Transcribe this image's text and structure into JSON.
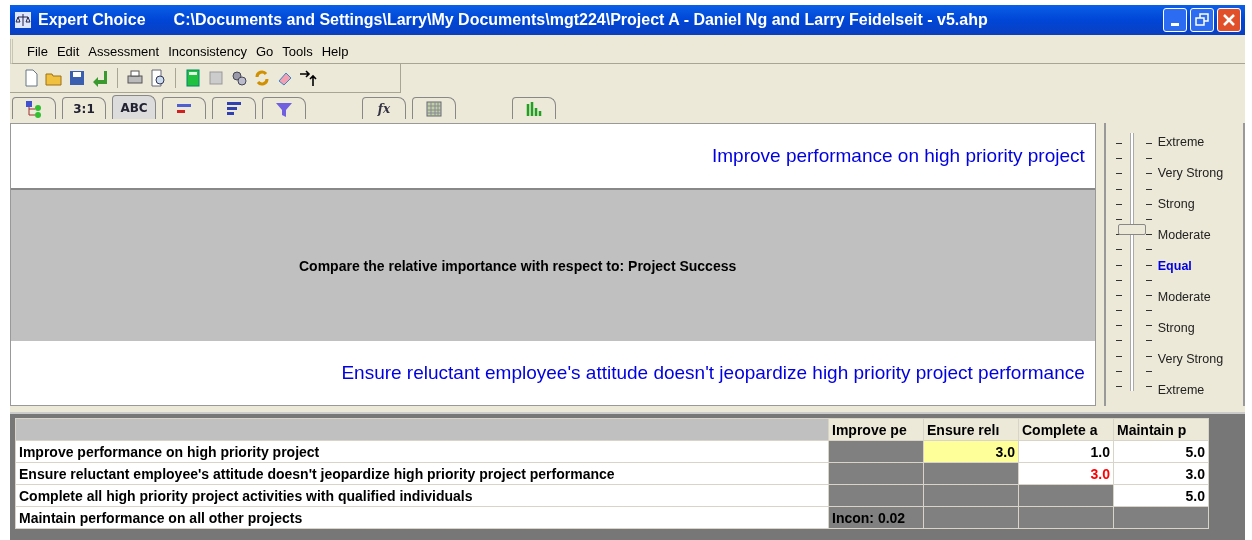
{
  "window": {
    "app_name": "Expert Choice",
    "title": "C:\\Documents and Settings\\Larry\\My Documents\\mgt224\\Project A - Daniel Ng and Larry Feidelseit - v5.ahp"
  },
  "menu": [
    "File",
    "Edit",
    "Assessment",
    "Inconsistency",
    "Go",
    "Tools",
    "Help"
  ],
  "tabs": [
    {
      "selected": false
    },
    {
      "label": "3:1",
      "selected": false
    },
    {
      "label": "ABC",
      "selected": true
    },
    {
      "selected": false
    },
    {
      "selected": false
    },
    {
      "selected": false
    },
    {
      "label": "fx",
      "selected": false
    },
    {
      "selected": false
    },
    {
      "selected": false
    }
  ],
  "comparison": {
    "top_item": "Improve performance on high priority project",
    "prompt": "Compare the relative importance with respect to: Project Success",
    "bottom_item": "Ensure reluctant employee's attitude doesn't jeopardize high priority project performance"
  },
  "scale": {
    "level": 0.625,
    "labels": [
      {
        "text": "Extreme",
        "kind": "normal"
      },
      {
        "text": "Very Strong",
        "kind": "normal"
      },
      {
        "text": "Strong",
        "kind": "normal"
      },
      {
        "text": "Moderate",
        "kind": "normal"
      },
      {
        "text": "Equal",
        "kind": "center"
      },
      {
        "text": "Moderate",
        "kind": "normal"
      },
      {
        "text": "Strong",
        "kind": "normal"
      },
      {
        "text": "Very Strong",
        "kind": "normal"
      },
      {
        "text": "Extreme",
        "kind": "normal"
      }
    ]
  },
  "matrix": {
    "columns": [
      "Improve pe",
      "Ensure relı",
      "Complete a",
      "Maintain p"
    ],
    "rows": [
      {
        "label": "Improve performance on high priority project",
        "cells": [
          {
            "kind": "empty"
          },
          {
            "kind": "value",
            "text": "3.0",
            "selected": true,
            "inverse": false
          },
          {
            "kind": "value",
            "text": "1.0",
            "selected": false,
            "inverse": false
          },
          {
            "kind": "value",
            "text": "5.0",
            "selected": false,
            "inverse": false
          }
        ]
      },
      {
        "label": "Ensure reluctant employee's attitude doesn't jeopardize high priority project performance",
        "cells": [
          {
            "kind": "empty"
          },
          {
            "kind": "empty"
          },
          {
            "kind": "value",
            "text": "3.0",
            "selected": false,
            "inverse": true
          },
          {
            "kind": "value",
            "text": "3.0",
            "selected": false,
            "inverse": false
          }
        ]
      },
      {
        "label": "Complete all high priority project activities with qualified individuals",
        "cells": [
          {
            "kind": "empty"
          },
          {
            "kind": "empty"
          },
          {
            "kind": "empty"
          },
          {
            "kind": "value",
            "text": "5.0",
            "selected": false,
            "inverse": false
          }
        ]
      },
      {
        "label": "Maintain performance on all other projects",
        "cells": [
          {
            "kind": "incon",
            "text": "Incon: 0.02"
          },
          {
            "kind": "empty"
          },
          {
            "kind": "empty"
          },
          {
            "kind": "empty"
          }
        ]
      }
    ]
  }
}
